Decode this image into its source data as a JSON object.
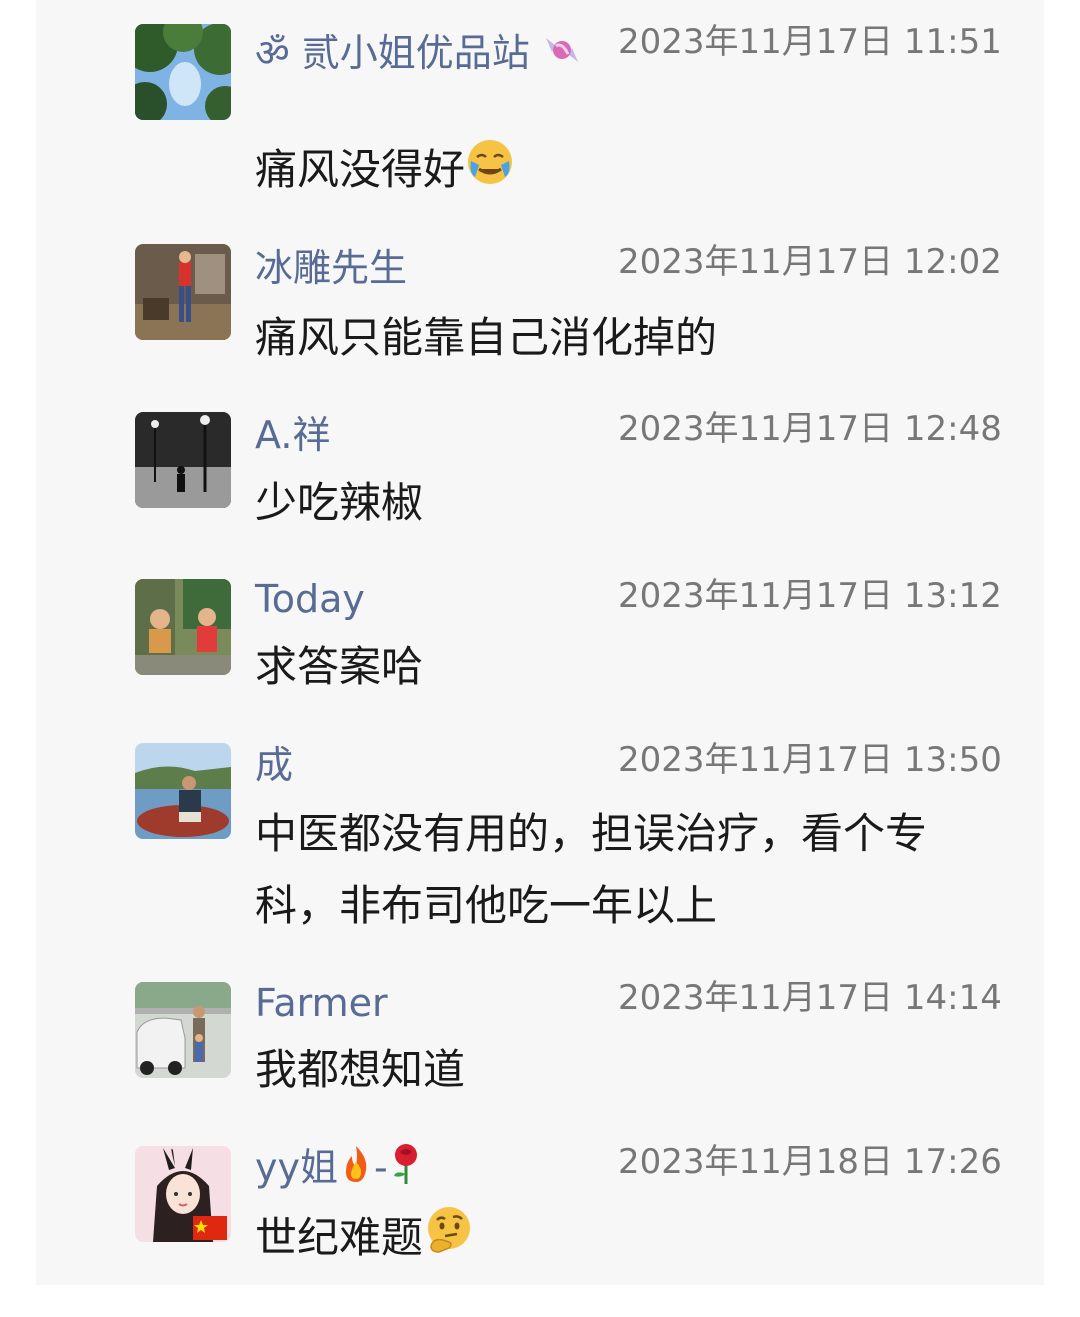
{
  "comments": [
    {
      "name_prefix": "ॐ",
      "name": "贰小姐优品站",
      "name_suffix_icon": "candy-icon",
      "time": "2023年11月17日 11:51",
      "text": "痛风没得好",
      "text_emoji": "crying-face-icon"
    },
    {
      "name": "冰雕先生",
      "time": "2023年11月17日 12:02",
      "text": "痛风只能靠自己消化掉的"
    },
    {
      "name": "A.祥",
      "time": "2023年11月17日 12:48",
      "text": "少吃辣椒"
    },
    {
      "name": "Today",
      "time": "2023年11月17日 13:12",
      "text": "求答案哈"
    },
    {
      "name": "成",
      "time": "2023年11月17日 13:50",
      "text_line1": "中医都没有用的，担误治疗，看个专",
      "text_line2": "科，非布司他吃一年以上"
    },
    {
      "name": "Farmer",
      "time": "2023年11月17日 14:14",
      "text": "我都想知道"
    },
    {
      "name": "yy姐",
      "name_fire_icon": "fire-icon",
      "name_dash": "-",
      "name_rose_icon": "rose-icon",
      "time": "2023年11月18日 17:26",
      "text": "世纪难题",
      "text_emoji": "thinking-face-icon"
    }
  ],
  "colors": {
    "name": "#576b95",
    "time": "#777777",
    "text": "#1a1a1a",
    "panel": "#f7f7f7"
  }
}
